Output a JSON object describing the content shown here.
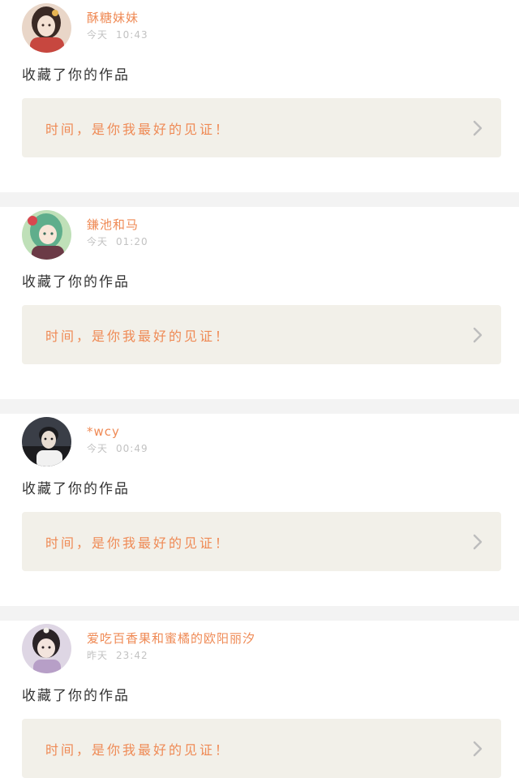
{
  "notifications": [
    {
      "username": "酥糖妹妹",
      "day": "今天",
      "time": "10:43",
      "action": "收藏了你的作品",
      "quote": "时间，是你我最好的见证！",
      "avatar_palette": [
        "#e9d6c8",
        "#3b2a25",
        "#f4e1d3",
        "#c7473f"
      ]
    },
    {
      "username": "鎌池和马",
      "day": "今天",
      "time": "01:20",
      "action": "收藏了你的作品",
      "quote": "时间，是你我最好的见证！",
      "avatar_palette": [
        "#bfe0b8",
        "#5fae8c",
        "#f8e6d8",
        "#d8474f"
      ]
    },
    {
      "username": "*wcy",
      "day": "今天",
      "time": "00:49",
      "action": "收藏了你的作品",
      "quote": "时间，是你我最好的见证！",
      "avatar_palette": [
        "#3a3e47",
        "#1c1c1f",
        "#e9ddd2",
        "#f1f1f1"
      ]
    },
    {
      "username": "爱吃百香果和蜜橘的欧阳丽汐",
      "day": "昨天",
      "time": "23:42",
      "action": "收藏了你的作品",
      "quote": "时间，是你我最好的见证！",
      "avatar_palette": [
        "#ded6e4",
        "#2a2326",
        "#f3e4dd",
        "#b79fc7"
      ]
    }
  ],
  "colors": {
    "accent": "#ef8a55",
    "quote_bg": "#f2f0e9",
    "timestamp": "#c2c2c2",
    "body_text": "#333333",
    "separator": "#f3f3f3"
  },
  "icons": {
    "chevron": "chevron-right-icon"
  }
}
